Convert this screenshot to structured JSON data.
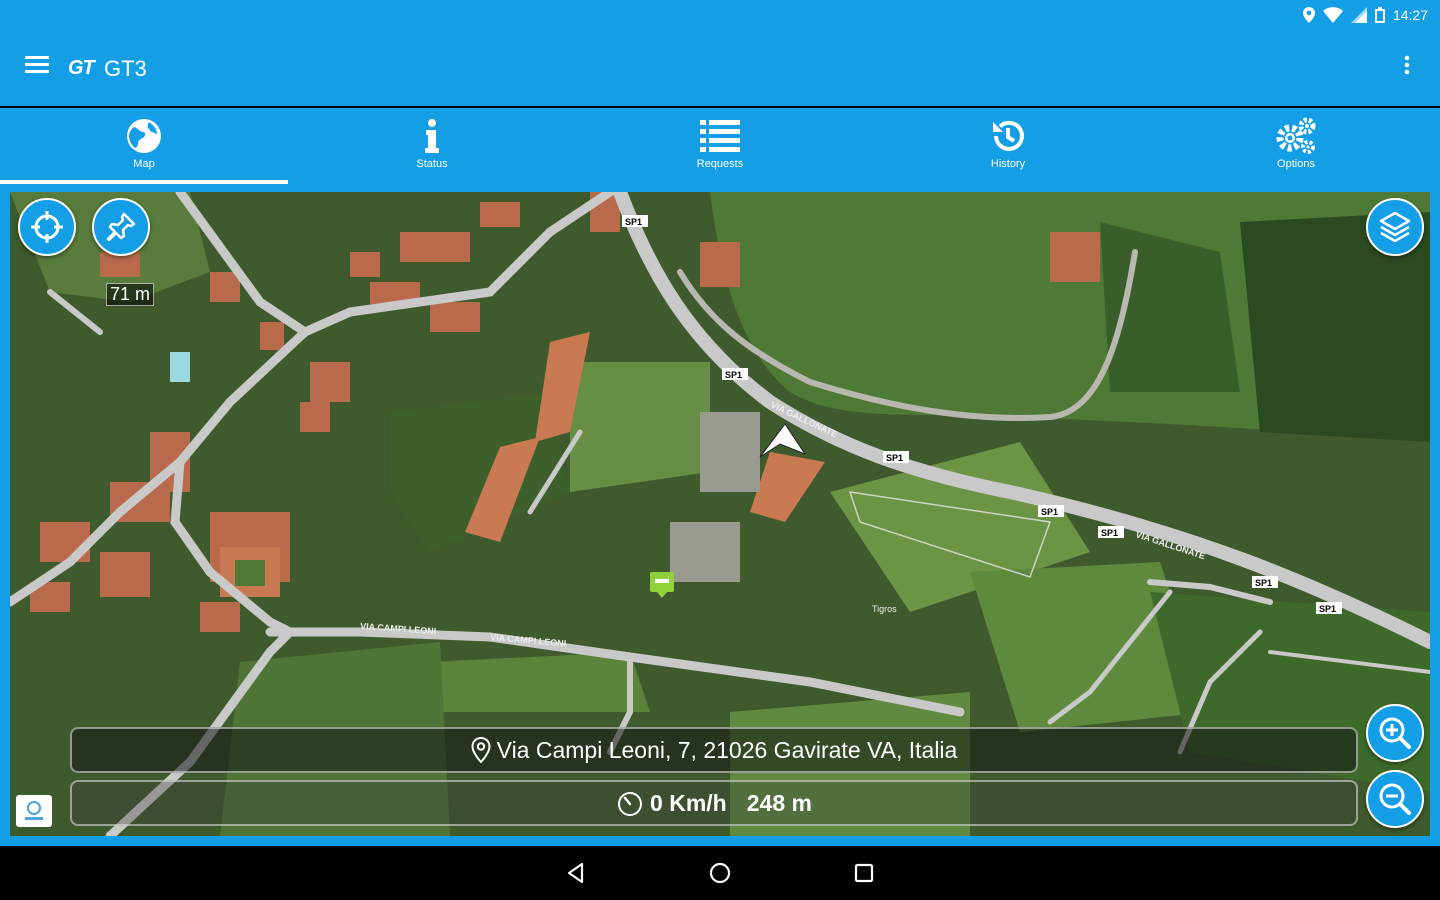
{
  "status_bar": {
    "time": "14:27",
    "icons": [
      "location-icon",
      "wifi-icon",
      "signal-icon",
      "battery-icon"
    ]
  },
  "app_bar": {
    "logo": "GT",
    "title": "GT3",
    "menu_icon": "hamburger-menu-icon",
    "overflow_icon": "more-vert-icon"
  },
  "tabs": [
    {
      "label": "Map",
      "icon": "globe-icon",
      "active": true
    },
    {
      "label": "Status",
      "icon": "info-icon",
      "active": false
    },
    {
      "label": "Requests",
      "icon": "list-icon",
      "active": false
    },
    {
      "label": "History",
      "icon": "history-icon",
      "active": false
    },
    {
      "label": "Options",
      "icon": "gears-icon",
      "active": false
    }
  ],
  "map": {
    "scale": "71 m",
    "address": "Via Campi Leoni, 7, 21026 Gavirate VA, Italia",
    "speed": "0 Km/h",
    "distance": "248 m",
    "road_labels": [
      "SP1",
      "SP1",
      "SP1",
      "SP1",
      "SP1",
      "SP1",
      "SP1",
      "VIA GALLONATE",
      "VIA GALLONATE",
      "VIA CAMPI LEONI",
      "VIA CAMPI LEONI",
      "Tigros"
    ]
  },
  "colors": {
    "primary": "#139ee6",
    "map_vegetation": "#3f5a2c",
    "road": "#c9c9c9"
  },
  "nav_bar": {
    "icons": [
      "back-icon",
      "home-icon",
      "recents-icon"
    ]
  }
}
